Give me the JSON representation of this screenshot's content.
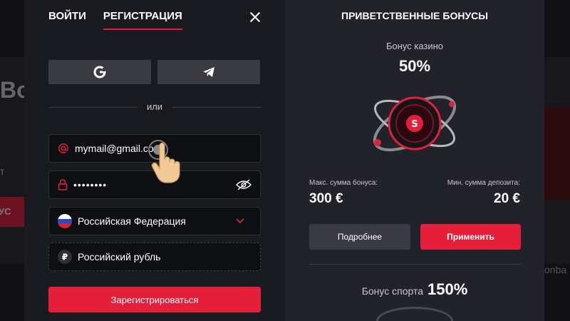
{
  "background": {
    "hero_text": "Bo",
    "hero_sub": "т",
    "hero_btn": "УС",
    "right_text": "onba"
  },
  "auth": {
    "tabs": [
      {
        "label": "Войти",
        "active": false
      },
      {
        "label": "Регистрация",
        "active": true
      }
    ],
    "social": [
      {
        "name": "google",
        "icon": "google-icon"
      },
      {
        "name": "telegram",
        "icon": "telegram-icon"
      }
    ],
    "divider_text": "или",
    "email": {
      "value": "mymail@gmail.com",
      "icon": "at-icon"
    },
    "password": {
      "value": "••••••••",
      "icon": "lock-icon",
      "toggle_icon": "eye-off-icon"
    },
    "country": {
      "value": "Российская Федерация",
      "icon": "russia-flag-icon"
    },
    "currency": {
      "value": "Российский рубль",
      "icon": "ruble-icon"
    },
    "register_label": "Зарегистрироваться"
  },
  "bonuses": {
    "title": "Приветственные бонусы",
    "casino": {
      "label": "Бонус казино",
      "percent": "50%",
      "max_label": "Макс. сумма бонуса:",
      "max_value": "300 €",
      "min_label": "Мин. сумма депозита:",
      "min_value": "20 €",
      "more_label": "Подробнее",
      "apply_label": "Применить"
    },
    "sport": {
      "label": "Бонус спорта",
      "percent": "150%"
    }
  },
  "colors": {
    "accent": "#e51e3a",
    "panel_left": "#1a1b20",
    "panel_right": "#22232a"
  }
}
